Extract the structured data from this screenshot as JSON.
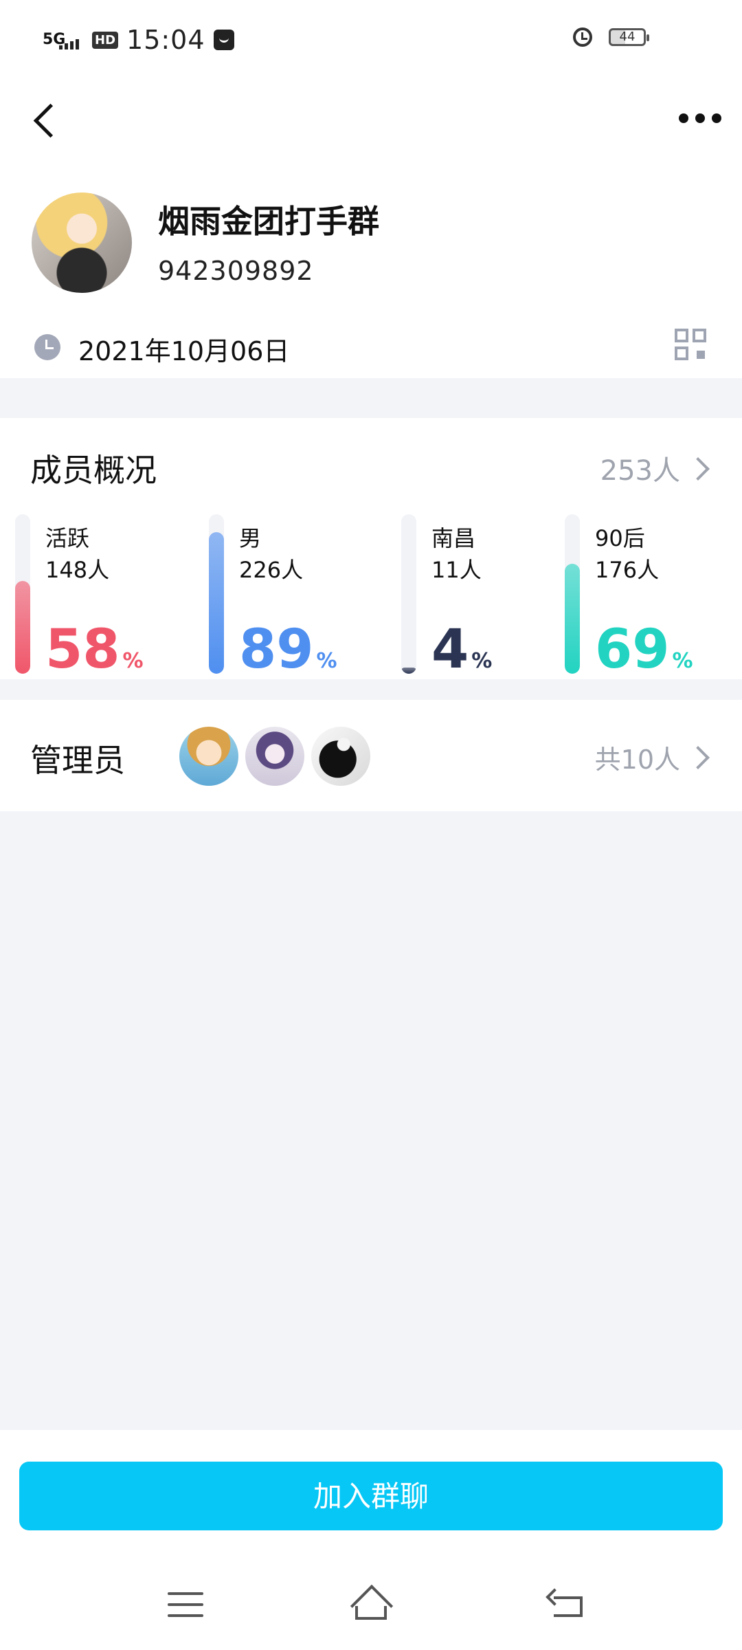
{
  "status_bar": {
    "network": "5G",
    "hd": "HD",
    "time": "15:04",
    "battery": "44",
    "icons": [
      "signal-icon",
      "hd-icon",
      "message-icon",
      "alarm-icon",
      "battery-icon"
    ]
  },
  "header": {
    "back_icon": "back-chevron-icon",
    "more_icon": "more-dots-icon"
  },
  "group": {
    "name": "烟雨金团打手群",
    "id": "942309892",
    "created_date": "2021年10月06日",
    "date_icon": "clock-icon",
    "qr_icon": "qr-code-icon"
  },
  "members": {
    "title": "成员概况",
    "total": "253人",
    "stats": [
      {
        "label": "活跃",
        "count": "148人",
        "percent": "58",
        "percent_sign": "%",
        "fill": 0.58,
        "color": "#f0566a"
      },
      {
        "label": "男",
        "count": "226人",
        "percent": "89",
        "percent_sign": "%",
        "fill": 0.89,
        "color": "#4f8ff0"
      },
      {
        "label": "南昌",
        "count": "11人",
        "percent": "4",
        "percent_sign": "%",
        "fill": 0.04,
        "color": "#2b3553"
      },
      {
        "label": "90后",
        "count": "176人",
        "percent": "69",
        "percent_sign": "%",
        "fill": 0.69,
        "color": "#22d3c1"
      }
    ]
  },
  "admins": {
    "title": "管理员",
    "count": "共10人"
  },
  "actions": {
    "join_label": "加入群聊"
  },
  "nav": {
    "menu_icon": "menu-icon",
    "home_icon": "home-icon",
    "back_icon": "back-icon"
  }
}
